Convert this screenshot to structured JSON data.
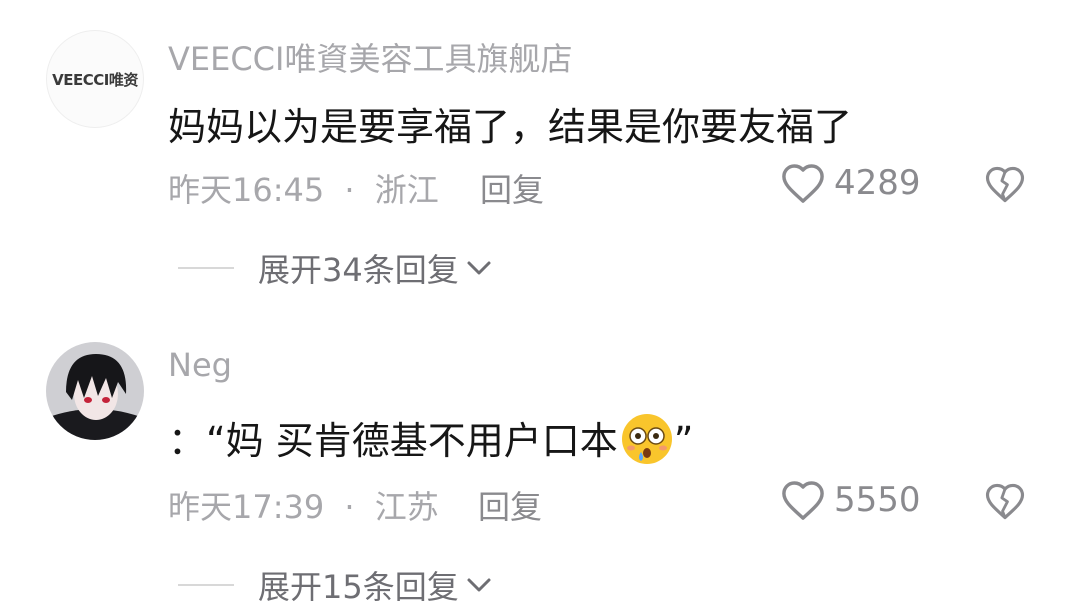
{
  "comments": [
    {
      "avatar_brand": "VEECCI唯资",
      "username": "VEECCI唯資美容工具旗舰店",
      "text": "妈妈以为是要享福了，结果是你要友福了",
      "time": "昨天16:45",
      "sep": "·",
      "location": "浙江",
      "reply_label": "回复",
      "likes": "4289",
      "expand_label": "展开34条回复"
    },
    {
      "username": "Neg",
      "text": "：“妈 买肯德基不用户口本",
      "text_end": "”",
      "emoji": "flushed-face-emoji",
      "time": "昨天17:39",
      "sep": "·",
      "location": "江苏",
      "reply_label": "回复",
      "likes": "5550",
      "expand_label": "展开15条回复"
    }
  ]
}
